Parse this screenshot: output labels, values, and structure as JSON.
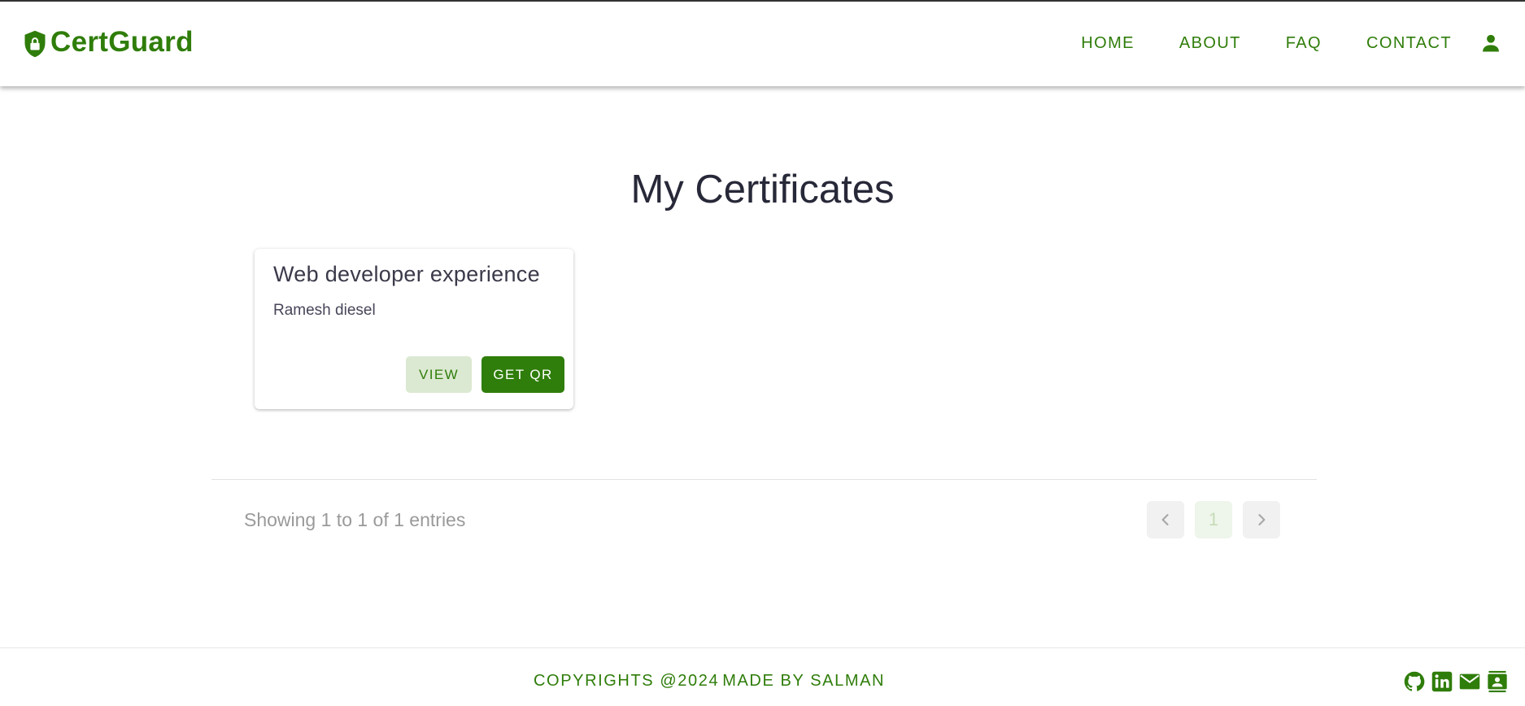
{
  "brand": {
    "name": "CertGuard",
    "icon": "shield-lock-icon"
  },
  "nav": {
    "items": [
      {
        "label": "HOME"
      },
      {
        "label": "ABOUT"
      },
      {
        "label": "FAQ"
      },
      {
        "label": "CONTACT"
      }
    ],
    "user_icon": "person-icon"
  },
  "main": {
    "title": "My Certificates",
    "certificates": [
      {
        "title": "Web developer experience",
        "recipient": "Ramesh diesel",
        "view_label": "VIEW",
        "qr_label": "GET QR"
      }
    ],
    "pagination": {
      "showing_text": "Showing 1 to 1 of 1 entries",
      "current_page": "1"
    }
  },
  "footer": {
    "copyright": "COPYRIGHTS @2024",
    "made_by": "MADE BY SALMAN",
    "social_icons": [
      "github-icon",
      "linkedin-icon",
      "mail-icon",
      "contact-card-icon"
    ]
  },
  "colors": {
    "accent": "#2f7d0a",
    "accent_light": "#dce9d2",
    "title_text": "#272838",
    "muted_text": "#9a9a9a"
  }
}
